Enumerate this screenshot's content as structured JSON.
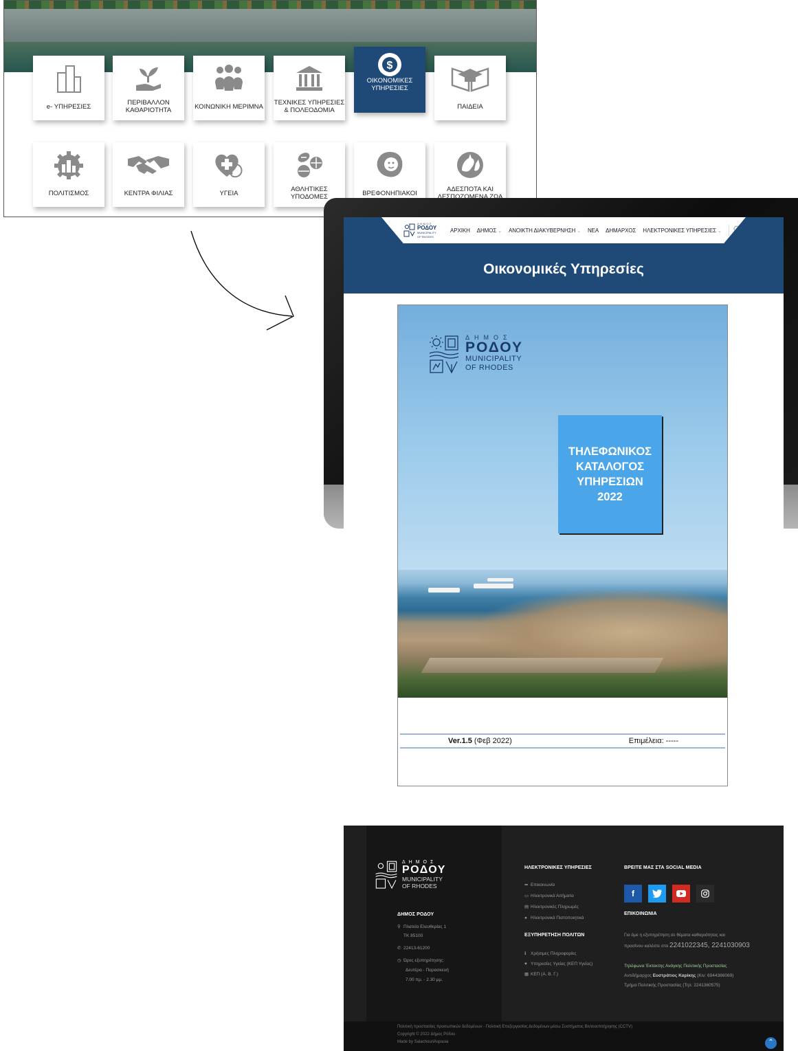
{
  "grid": {
    "tiles": [
      {
        "label": "e- ΥΠΗΡΕΣΙΕΣ",
        "icon": "buildings-icon"
      },
      {
        "label": "ΠΕΡΙΒΑΛΛΟΝ\nΚΑΘΑΡΙΟΤΗΤΑ",
        "icon": "plant-hand-icon"
      },
      {
        "label": "ΚΟΙΝΩΝΙΚΗ ΜΕΡΙΜΝΑ",
        "icon": "people-icon"
      },
      {
        "label": "ΤΕΧΝΙΚΕΣ ΥΠΗΡΕΣΙΕΣ\n& ΠΟΛΕΟΔΟΜΙΑ",
        "icon": "columns-icon"
      },
      {
        "label": "ΟΙΚΟΝΟΜΙΚΕΣ\nΥΠΗΡΕΣΙΕΣ",
        "icon": "globe-dollar-icon",
        "active": true
      },
      {
        "label": "ΠΑΙΔΕΙΑ",
        "icon": "graduation-book-icon"
      },
      {
        "label": "ΠΟΛΙΤΙΣΜΟΣ",
        "icon": "gear-city-icon"
      },
      {
        "label": "ΚΕΝΤΡΑ ΦΙΛΙΑΣ",
        "icon": "handshake-icon"
      },
      {
        "label": "ΥΓΕΙΑ",
        "icon": "heart-stethoscope-icon"
      },
      {
        "label": "ΑΘΛΗΤΙΚΕΣ\nΥΠΟΔΟΜΕΣ",
        "icon": "sports-balls-icon"
      },
      {
        "label": "ΒΡΕΦΟΝΗΠΙΑΚΟΙ",
        "icon": "baby-icon"
      },
      {
        "label": "ΑΔΕΣΠΟΤΑ ΚΑΙ\nΔΕΣΠΟΖΟΜΕΝΑ ΖΩΑ",
        "icon": "animals-icon"
      }
    ]
  },
  "nav": {
    "logo_small": "ΔΗΜΟΣ",
    "logo_big": "ΡΟΔΟΥ",
    "logo_sub1": "MUNICIPALITY",
    "logo_sub2": "OF RHODES",
    "items": [
      {
        "label": "ΑΡΧΙΚΗ",
        "dropdown": false
      },
      {
        "label": "ΔΗΜΟΣ",
        "dropdown": true
      },
      {
        "label": "ΑΝΟΙΚΤΗ ΔΙΑΚΥΒΕΡΝΗΣΗ",
        "dropdown": true
      },
      {
        "label": "ΝΕΑ",
        "dropdown": false
      },
      {
        "label": "ΔΗΜΑΡΧΟΣ",
        "dropdown": false
      },
      {
        "label": "ΗΛΕΚΤΡΟΝΙΚΕΣ ΥΠΗΡΕΣΙΕΣ",
        "dropdown": true
      }
    ]
  },
  "page": {
    "title": "Οικονομικές Υπηρεσίες"
  },
  "document": {
    "logo_small": "ΔΗΜΟΣ",
    "logo_big": "ΡΟΔΟΥ",
    "logo_sub1": "MUNICIPALITY",
    "logo_sub2": "OF RHODES",
    "badge": "ΤΗΛΕΦΩΝΙΚΟΣ\nΚΑΤΑΛΟΓΟΣ\nΥΠΗΡΕΣΙΩΝ\n2022",
    "version_bold": "Ver.1.5",
    "version_rest": " (Φεβ 2022)",
    "editor": "Επιμέλεια: -----"
  },
  "footer": {
    "logo_small": "ΔΗΜΟΣ",
    "logo_big": "ΡΟΔΟΥ",
    "logo_sub1": "MUNICIPALITY",
    "logo_sub2": "OF RHODES",
    "org": "ΔΗΜΟΣ ΡΟΔΟΥ",
    "address1": "Πλατεία Ελευθερίας 1",
    "address2": "ΤΚ 85100",
    "phone": "22413-61200",
    "hours_label": "Ώρες εξυπηρέτησης:",
    "hours_days": "Δευτέρα - Παρασκευή",
    "hours_time": "7.00 πμ. - 2.30 μμ.",
    "eservices_head": "ΗΛΕΚΤΡΟΝΙΚΕΣ ΥΠΗΡΕΣΙΕΣ",
    "eservices": [
      "Επικοινωνία",
      "Ηλεκτρονικά Αιτήματα",
      "Ηλεκτρονικές Πληρωμές",
      "Ηλεκτρονικά Πιστοποιητικά"
    ],
    "citizens_head": "ΕΞΥΠΗΡΕΤΗΣΗ ΠΟΛΙΤΩΝ",
    "citizens": [
      "Χρήσιμες Πληροφορίες",
      "Υπηρεσίες Υγείας (ΚΕΠ Υγείας)",
      "ΚΕΠ (Α. Β. Γ.)"
    ],
    "social_head": "ΒΡΕΙΤΕ ΜΑΣ ΣΤΑ SOCIAL MEDIA",
    "contact_head": "ΕΠΙΚΟΙΝΩΝΙΑ",
    "contact_text1": "Για άμε  η εξυπηρέτηση σε θέματα καθαριότητας και",
    "contact_text2": "πρασίνου καλέστε στα",
    "contact_phones": "2241022345, 2241030903",
    "emergency_head": "Τηλέφωνα Έκτακτης Ανάγκης Πολιτικής Προστασίας",
    "emergency_line1_pre": "Αντιδήμαρχος",
    "emergency_line1_name": "Ευστράτιος Καρίκης",
    "emergency_line1_post": "(Κιν: 6944386069)",
    "emergency_line2": "Τμήμα Πολιτικής Προστασίας  (Τηλ: 2241360575)",
    "bottom1": "Πολιτική προστασίας προσωπικών δεδομένων - Πολιτική Επεξεργασίας Δεδομένων μέσω Συστήματος Βιντεοεπιτήρησης (CCTV)",
    "bottom2": "Copyright © 2022 Δήμος Ρόδου",
    "bottom3": "Made by SalachouriAspasia"
  },
  "colors": {
    "brand_blue": "#1f4a78",
    "badge_blue": "#4aa6e8",
    "facebook": "#1d59a8",
    "twitter": "#1d9bf0",
    "youtube": "#d22b22",
    "instagram": "#2a2a2a",
    "emergency_green": "#9fd39a"
  }
}
